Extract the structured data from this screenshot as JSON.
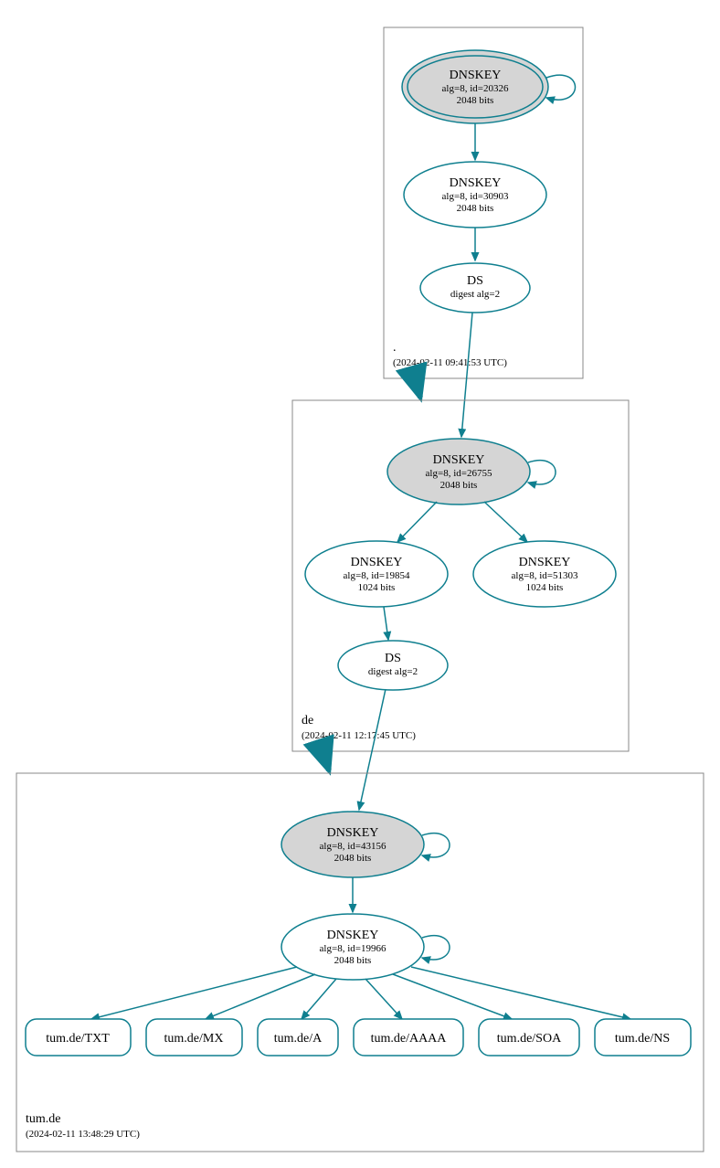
{
  "zones": {
    "root": {
      "name": ".",
      "timestamp": "(2024-02-11 09:41:53 UTC)",
      "ksk": {
        "title": "DNSKEY",
        "line2": "alg=8, id=20326",
        "line3": "2048 bits"
      },
      "zsk": {
        "title": "DNSKEY",
        "line2": "alg=8, id=30903",
        "line3": "2048 bits"
      },
      "ds": {
        "title": "DS",
        "line2": "digest alg=2"
      }
    },
    "de": {
      "name": "de",
      "timestamp": "(2024-02-11 12:17:45 UTC)",
      "ksk": {
        "title": "DNSKEY",
        "line2": "alg=8, id=26755",
        "line3": "2048 bits"
      },
      "zsk1": {
        "title": "DNSKEY",
        "line2": "alg=8, id=19854",
        "line3": "1024 bits"
      },
      "zsk2": {
        "title": "DNSKEY",
        "line2": "alg=8, id=51303",
        "line3": "1024 bits"
      },
      "ds": {
        "title": "DS",
        "line2": "digest alg=2"
      }
    },
    "tumde": {
      "name": "tum.de",
      "timestamp": "(2024-02-11 13:48:29 UTC)",
      "ksk": {
        "title": "DNSKEY",
        "line2": "alg=8, id=43156",
        "line3": "2048 bits"
      },
      "zsk": {
        "title": "DNSKEY",
        "line2": "alg=8, id=19966",
        "line3": "2048 bits"
      },
      "rr": {
        "txt": "tum.de/TXT",
        "mx": "tum.de/MX",
        "a": "tum.de/A",
        "aaaa": "tum.de/AAAA",
        "soa": "tum.de/SOA",
        "ns": "tum.de/NS"
      }
    }
  }
}
